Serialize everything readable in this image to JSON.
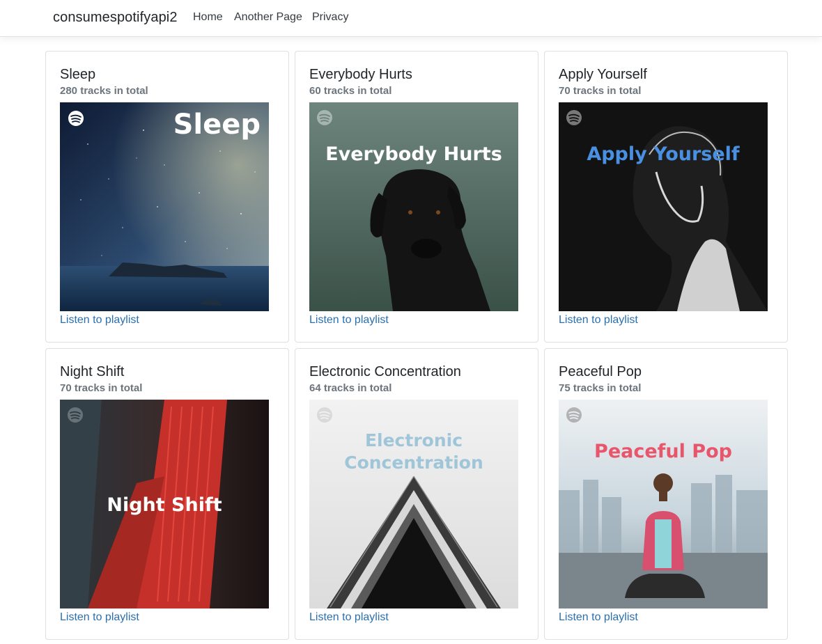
{
  "nav": {
    "brand": "consumespotifyapi2",
    "links": [
      "Home",
      "Another Page",
      "Privacy"
    ]
  },
  "playlists": [
    {
      "title": "Sleep",
      "tracks": "280 tracks in total",
      "cover_text": "Sleep",
      "link": "Listen to playlist"
    },
    {
      "title": "Everybody Hurts",
      "tracks": "60 tracks in total",
      "cover_text": "Everybody Hurts",
      "link": "Listen to playlist"
    },
    {
      "title": "Apply Yourself",
      "tracks": "70 tracks in total",
      "cover_text": "Apply Yourself",
      "link": "Listen to playlist"
    },
    {
      "title": "Night Shift",
      "tracks": "70 tracks in total",
      "cover_text": "Night Shift",
      "link": "Listen to playlist"
    },
    {
      "title": "Electronic Concentration",
      "tracks": "64 tracks in total",
      "cover_text_line1": "Electronic",
      "cover_text_line2": "Concentration",
      "link": "Listen to playlist"
    },
    {
      "title": "Peaceful Pop",
      "tracks": "75 tracks in total",
      "cover_text": "Peaceful Pop",
      "link": "Listen to playlist"
    }
  ],
  "icons": {
    "cover_badge": "spotify-logo-icon"
  },
  "colors": {
    "link": "#2a6fb0",
    "subtitle": "#6c757d",
    "apply_yourself_text": "#4a90e2",
    "electronic_text": "#9fc6d8",
    "peaceful_text": "#e8566c"
  }
}
